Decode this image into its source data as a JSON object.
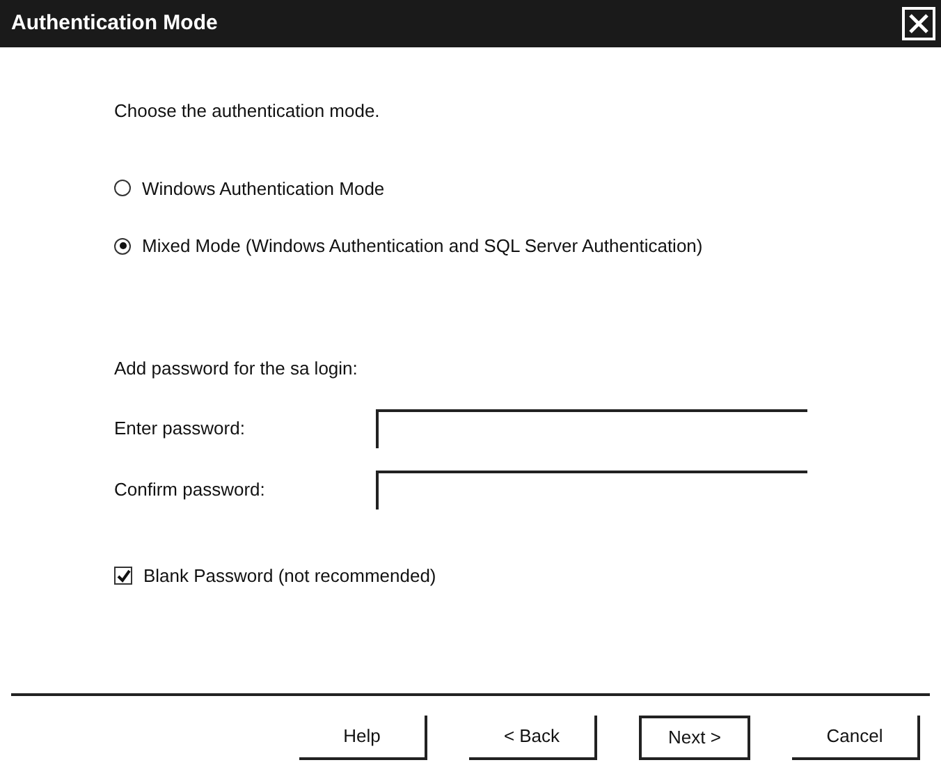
{
  "window": {
    "title": "Authentication Mode"
  },
  "prompt": "Choose the authentication mode.",
  "modes": [
    {
      "label": "Windows Authentication Mode",
      "selected": false
    },
    {
      "label": "Mixed Mode (Windows Authentication and SQL Server Authentication)",
      "selected": true
    }
  ],
  "password_section": {
    "heading": "Add password for the sa login:",
    "fields": [
      {
        "label": "Enter password:"
      },
      {
        "label": "Confirm password:"
      }
    ],
    "blank_password": {
      "label": "Blank Password (not recommended)",
      "checked": true
    }
  },
  "buttons": [
    {
      "label": "Help",
      "default": false
    },
    {
      "label": "< Back",
      "default": false
    },
    {
      "label": "Next >",
      "default": true
    },
    {
      "label": "Cancel",
      "default": false
    }
  ]
}
